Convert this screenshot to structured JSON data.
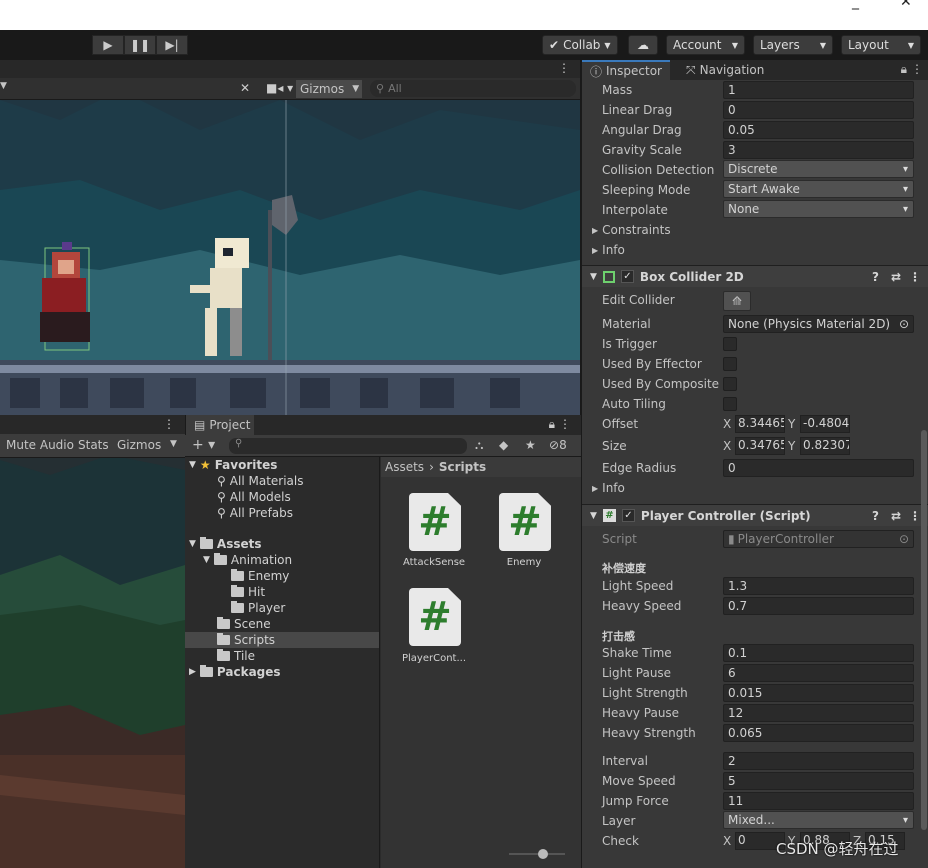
{
  "window": {
    "controls": [
      "_",
      "✕"
    ]
  },
  "toolbar": {
    "collab_label": "Collab",
    "account_label": "Account",
    "layers_label": "Layers",
    "layout_label": "Layout"
  },
  "scene_view": {
    "gizmos_label": "Gizmos",
    "search_placeholder": "All"
  },
  "game_view": {
    "mute_audio_label": "Mute Audio",
    "stats_label": "Stats",
    "gizmos_label": "Gizmos"
  },
  "project": {
    "tab_label": "Project",
    "hidden_count": "8",
    "breadcrumb": [
      "Assets",
      "Scripts"
    ],
    "tree": {
      "favorites_label": "Favorites",
      "favorites": [
        "All Materials",
        "All Models",
        "All Prefabs"
      ],
      "assets_label": "Assets",
      "animation_label": "Animation",
      "animation_children": [
        "Enemy",
        "Hit",
        "Player"
      ],
      "scene_label": "Scene",
      "scripts_label": "Scripts",
      "tile_label": "Tile",
      "packages_label": "Packages"
    },
    "files": [
      "AttackSense",
      "Enemy",
      "PlayerCont..."
    ]
  },
  "inspector": {
    "tab_label": "Inspector",
    "navigation_label": "Navigation",
    "rigidbody": {
      "mass_label": "Mass",
      "mass": "1",
      "linear_drag_label": "Linear Drag",
      "linear_drag": "0",
      "angular_drag_label": "Angular Drag",
      "angular_drag": "0.05",
      "gravity_scale_label": "Gravity Scale",
      "gravity_scale": "3",
      "collision_detection_label": "Collision Detection",
      "collision_detection": "Discrete",
      "sleeping_mode_label": "Sleeping Mode",
      "sleeping_mode": "Start Awake",
      "interpolate_label": "Interpolate",
      "interpolate": "None",
      "constraints_label": "Constraints",
      "info_label": "Info"
    },
    "box_collider": {
      "title": "Box Collider 2D",
      "edit_collider_label": "Edit Collider",
      "material_label": "Material",
      "material": "None (Physics Material 2D)",
      "is_trigger_label": "Is Trigger",
      "used_by_effector_label": "Used By Effector",
      "used_by_composite_label": "Used By Composite",
      "auto_tiling_label": "Auto Tiling",
      "offset_label": "Offset",
      "offset_x": "8.34465",
      "offset_y": "-0.4804",
      "size_label": "Size",
      "size_x": "0.34765",
      "size_y": "0.82307",
      "edge_radius_label": "Edge Radius",
      "edge_radius": "0",
      "info_label": "Info"
    },
    "player_controller": {
      "title": "Player Controller (Script)",
      "script_label": "Script",
      "script": "PlayerController",
      "section1": "补偿速度",
      "light_speed_label": "Light Speed",
      "light_speed": "1.3",
      "heavy_speed_label": "Heavy Speed",
      "heavy_speed": "0.7",
      "section2": "打击感",
      "shake_time_label": "Shake Time",
      "shake_time": "0.1",
      "light_pause_label": "Light Pause",
      "light_pause": "6",
      "light_strength_label": "Light Strength",
      "light_strength": "0.015",
      "heavy_pause_label": "Heavy Pause",
      "heavy_pause": "12",
      "heavy_strength_label": "Heavy Strength",
      "heavy_strength": "0.065",
      "interval_label": "Interval",
      "interval": "2",
      "move_speed_label": "Move Speed",
      "move_speed": "5",
      "jump_force_label": "Jump Force",
      "jump_force": "11",
      "layer_label": "Layer",
      "layer": "Mixed...",
      "check_label": "Check",
      "check_x": "0",
      "check_y": "0.88",
      "check_z": "0.15"
    }
  },
  "watermark": "CSDN @轻舟在过"
}
